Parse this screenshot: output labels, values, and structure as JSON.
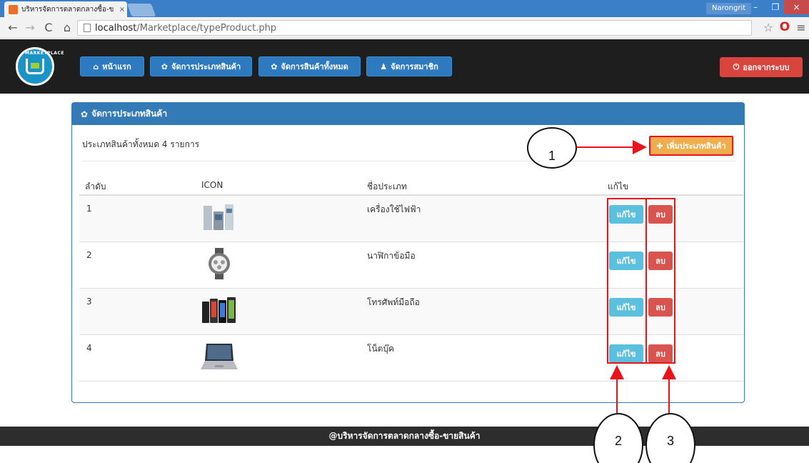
{
  "browser": {
    "tab_title": "บริหารจัดการตลาดกลางซื้อ-ข",
    "tab_close": "×",
    "user": "Narongrit",
    "url_host": "localhost",
    "url_path": "/Marketplace/typeProduct.php",
    "win_min": "–",
    "win_max": "❐",
    "win_close": "×"
  },
  "navbar": {
    "logo_text": "MARKETPLACE",
    "home": "หน้าแรก",
    "manage_types": "จัดการประเภทสินค้า",
    "manage_products": "จัดการสินค้าทั้งหมด",
    "manage_members": "จัดการสมาชิก",
    "logout": "ออกจากระบบ"
  },
  "panel": {
    "title": "จัดการประเภทสินค้า",
    "total_text": "ประเภทสินค้าทั้งหมด 4 รายการ",
    "add_button": "เพิ่มประเภทสินค้า",
    "columns": {
      "no": "ลำดับ",
      "icon": "ICON",
      "name": "ชื่อประเภท",
      "edit": "แก้ไข"
    },
    "rows": [
      {
        "no": "1",
        "name": "เครื่องใช้ไฟฟ้า",
        "icon": "appliances-icon",
        "edit": "แก้ไข",
        "delete": "ลบ"
      },
      {
        "no": "2",
        "name": "นาฬิกาข้อมือ",
        "icon": "watch-icon",
        "edit": "แก้ไข",
        "delete": "ลบ"
      },
      {
        "no": "3",
        "name": "โทรศัพท์มือถือ",
        "icon": "phones-icon",
        "edit": "แก้ไข",
        "delete": "ลบ"
      },
      {
        "no": "4",
        "name": "โน็ตบุ๊ค",
        "icon": "laptop-icon",
        "edit": "แก้ไข",
        "delete": "ลบ"
      }
    ]
  },
  "footer": {
    "text": "@บริหารจัดการตลาดกลางซื้อ-ขายสินค้า"
  },
  "annotations": {
    "callout_1": "1",
    "callout_2": "2",
    "callout_3": "3",
    "highlight_color": "#e8141a"
  }
}
